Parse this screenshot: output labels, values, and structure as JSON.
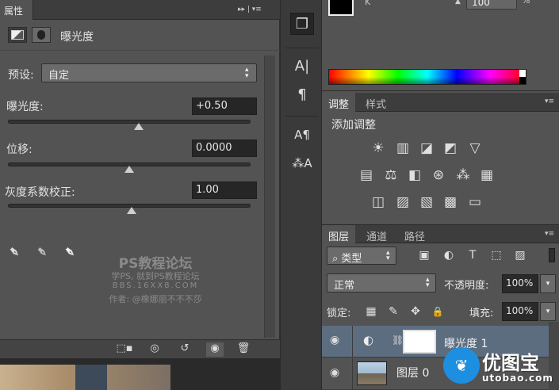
{
  "properties_panel": {
    "tab_title": "属性",
    "header_ctrl": "▸▸ | ▾≡",
    "adjustment_name": "曝光度",
    "preset": {
      "label": "预设:",
      "value": "自定"
    },
    "sliders": [
      {
        "label": "曝光度:",
        "value": "+0.50",
        "position": 0.54
      },
      {
        "label": "位移:",
        "value": "0.0000",
        "position": 0.5
      },
      {
        "label": "灰度系数校正:",
        "value": "1.00",
        "position": 0.51
      }
    ],
    "watermark": {
      "line1": "PS教程论坛",
      "line2": "学PS, 就到PS教程论坛",
      "line3": "BBS.16XX8.COM",
      "line4": "作者: @橡娜丽不不不莎"
    }
  },
  "toolbar": {
    "buttons": [
      "❐",
      "A|",
      "¶",
      "A¶",
      "⁂A"
    ]
  },
  "color_panel": {
    "channel_label": "K",
    "value": "100",
    "unit": "%"
  },
  "adjustments_panel": {
    "tabs": [
      "调整",
      "样式"
    ],
    "title": "添加调整",
    "row1": [
      "☀",
      "▥",
      "◪",
      "◩",
      "▽"
    ],
    "row2": [
      "▤",
      "⚖",
      "◧",
      "⊛",
      "⁂",
      "▦"
    ],
    "row3": [
      "◫",
      "▨",
      "▧",
      "▩",
      "▭"
    ]
  },
  "layers_panel": {
    "tabs": [
      "图层",
      "通道",
      "路径"
    ],
    "filter": {
      "icon": "⌕",
      "label": "类型"
    },
    "filter_icons": [
      "▣",
      "◐",
      "T",
      "⬚",
      "▨"
    ],
    "blend_mode": "正常",
    "opacity": {
      "label": "不透明度:",
      "value": "100%"
    },
    "lock": {
      "label": "锁定:",
      "icons": [
        "▦",
        "✎",
        "✥",
        "🔒"
      ]
    },
    "fill": {
      "label": "填充:",
      "value": "100%"
    },
    "layers": [
      {
        "name": "曝光度 1",
        "selected": true
      },
      {
        "name": "图层 0",
        "selected": false
      }
    ]
  },
  "logo": {
    "name": "优图宝",
    "url": "utobao.com"
  }
}
